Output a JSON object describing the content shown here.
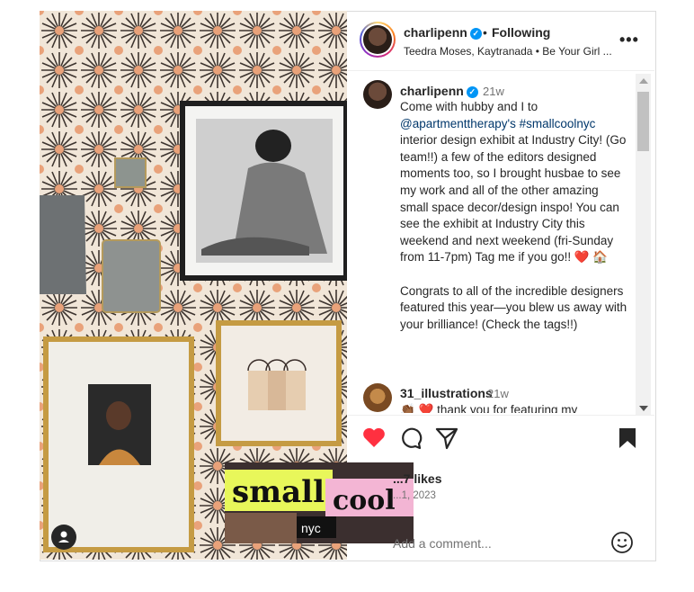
{
  "post": {
    "username": "charlipenn",
    "separator": "•",
    "follow_label": "Following",
    "audio": "Teedra Moses, Kaytranada • Be Your Girl ...",
    "more_label": "•••"
  },
  "caption": {
    "username": "charlipenn",
    "time": "21w",
    "paragraphs": [
      "Come with hubby and I to @apartmenttherapy's #smallcoolnyc interior design exhibit at Industry City! (Go team!!) a few of the editors designed moments too, so I brought husbae to see my work and all of the other amazing small space decor/design inspo! You can see the exhibit at Industry City this weekend and next weekend (fri-Sunday from 11-7pm) Tag me if you go!! ❤️ 🏠",
      "Congrats to all of the incredible designers featured this year—you blew us away with your brilliance! (Check the tags!!)"
    ],
    "link_mention": "@apartmenttherapy's",
    "link_hashtag": "#smallcoolnyc"
  },
  "comment": {
    "username": "31_illustrations",
    "time": "21w",
    "text": "👏🏾 ❤️  thank you for featuring my"
  },
  "footer": {
    "likes": "...7 likes",
    "date": "...1, 2023",
    "add_comment_placeholder": "Add a comment..."
  },
  "sticker": {
    "word1": "small",
    "word2": "cool",
    "tag": "nyc"
  },
  "icons": {
    "like": "heart-icon",
    "comment": "comment-icon",
    "share": "share-icon",
    "save": "bookmark-icon",
    "emoji": "smiley-icon",
    "tag": "user-tag-icon",
    "verified": "verified-badge-icon"
  },
  "colors": {
    "like_red": "#ff3040",
    "verified_blue": "#0095f6",
    "link": "#00376b"
  }
}
